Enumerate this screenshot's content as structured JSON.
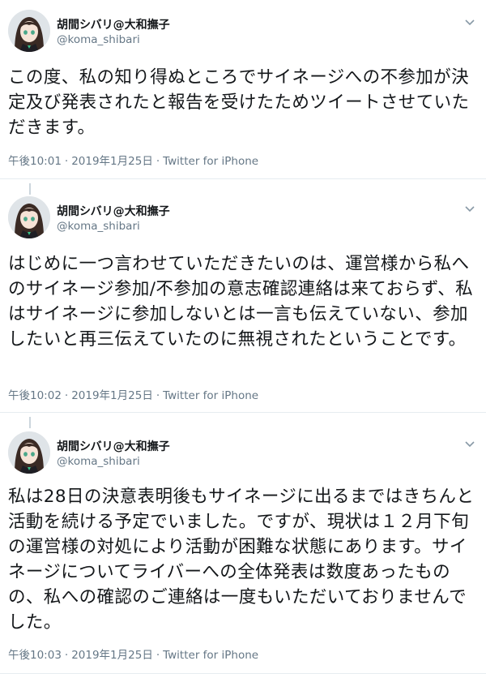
{
  "author": {
    "display_name": "胡間シバリ@大和撫子",
    "handle": "@koma_shibari",
    "avatar_icon": "anime-girl-avatar"
  },
  "tweets": [
    {
      "text": "この度、私の知り得ぬところでサイネージへの不参加が決定及び発表されたと報告を受けたためツイートさせていただきます。",
      "time": "午後10:01",
      "date": "2019年1月25日",
      "source": "Twitter for iPhone"
    },
    {
      "text": "はじめに一つ言わせていただきたいのは、運営様から私へのサイネージ参加/不参加の意志確認連絡は来ておらず、私はサイネージに参加しないとは一言も伝えていない、参加したいと再三伝えていたのに無視されたということです。",
      "time": "午後10:02",
      "date": "2019年1月25日",
      "source": "Twitter for iPhone"
    },
    {
      "text": "私は28日の決意表明後もサイネージに出るまではきちんと活動を続ける予定でいました。ですが、現状は１２月下旬の運営様の対処により活動が困難な状態にあります。サイネージについてライバーへの全体発表は数度あったものの、私への確認のご連絡は一度もいただいておりませんでした。",
      "time": "午後10:03",
      "date": "2019年1月25日",
      "source": "Twitter for iPhone"
    }
  ],
  "meta_separator": "·",
  "colors": {
    "text": "#14171a",
    "secondary": "#657786",
    "divider": "#e6ecf0",
    "thread_line": "#ccd6dd"
  }
}
